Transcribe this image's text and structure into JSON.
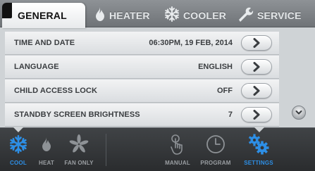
{
  "tabs": [
    {
      "label": "GENERAL",
      "icon": "flag-icon",
      "active": true
    },
    {
      "label": "HEATER",
      "icon": "flame-icon",
      "active": false
    },
    {
      "label": "COOLER",
      "icon": "snowflake-icon",
      "active": false
    },
    {
      "label": "SERVICE",
      "icon": "wrench-icon",
      "active": false
    }
  ],
  "settings": [
    {
      "label": "TIME AND DATE",
      "value": "06:30PM, 19 FEB, 2014"
    },
    {
      "label": "LANGUAGE",
      "value": "ENGLISH"
    },
    {
      "label": "CHILD ACCESS LOCK",
      "value": "OFF"
    },
    {
      "label": "STANDBY SCREEN BRIGHTNESS",
      "value": "7"
    }
  ],
  "nav": {
    "cool": "COOL",
    "heat": "HEAT",
    "fan_only": "FAN ONLY",
    "manual": "MANUAL",
    "program": "PROGRAM",
    "settings": "SETTINGS"
  },
  "colors": {
    "accent": "#2d8fe6",
    "tab_active": "#ffffff",
    "tab_bar": "#7f8387",
    "list_bg": "#cfd3d6",
    "bottom_bar": "#333537"
  }
}
